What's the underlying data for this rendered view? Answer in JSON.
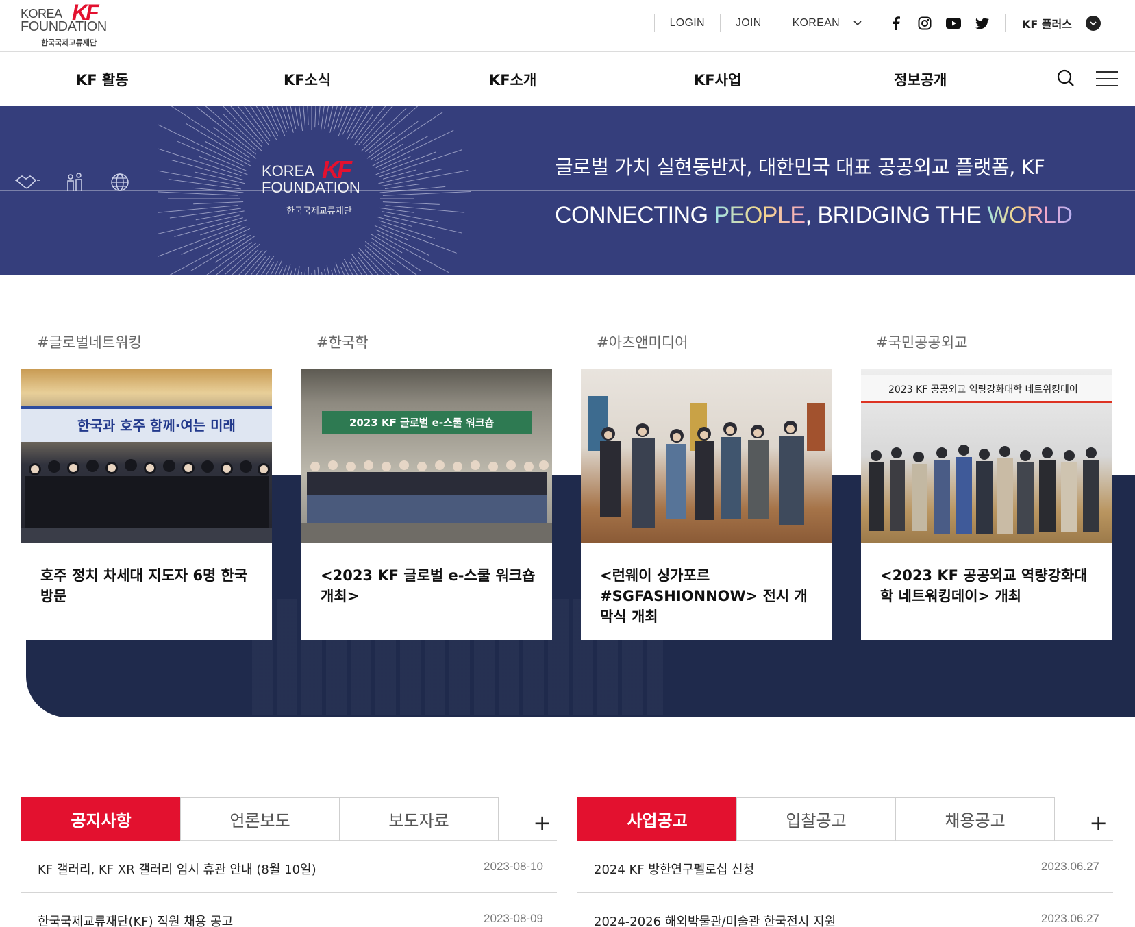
{
  "header": {
    "logo": {
      "line1": "KOREA",
      "line2": "FOUNDATION",
      "mark": "KF",
      "korean": "한국국제교류재단"
    },
    "util": {
      "login": "LOGIN",
      "join": "JOIN",
      "language": "KOREAN",
      "kfplus": "KF 플러스"
    },
    "social_icons": [
      "facebook-icon",
      "instagram-icon",
      "youtube-icon",
      "twitter-icon"
    ]
  },
  "nav": {
    "items": [
      "KF 활동",
      "KF소식",
      "KF소개",
      "KF사업",
      "정보공개"
    ]
  },
  "hero": {
    "logo": {
      "line1": "KOREA",
      "line2": "FOUNDATION",
      "mark": "KF",
      "korean": "한국국제교류재단"
    },
    "subtitle": "글로벌 가치 실현동반자, 대한민국 대표 공공외교 플랫폼, KF",
    "slogan": {
      "p1": "CONNECTING ",
      "p2": "PEOPLE",
      "p3": ", BRIDGING THE ",
      "p4": "WORLD"
    }
  },
  "cards": [
    {
      "tag": "#글로벌네트워킹",
      "title": "호주 정치 차세대 지도자 6명 한국 방문",
      "banner": "한국과 호주 함께·여는 미래"
    },
    {
      "tag": "#한국학",
      "title": "<2023 KF 글로벌 e-스쿨 워크숍 개최>",
      "banner": "2023 KF 글로벌 e-스쿨 워크숍"
    },
    {
      "tag": "#아츠앤미디어",
      "title": "<런웨이 싱가포르 #SGFASHIONNOW> 전시 개막식 개최",
      "banner": ""
    },
    {
      "tag": "#국민공공외교",
      "title": "<2023 KF 공공외교 역량강화대학 네트워킹데이> 개최",
      "banner": "2023 KF 공공외교 역량강화대학 네트워킹데이"
    }
  ],
  "board_left": {
    "tabs": [
      "공지사항",
      "언론보도",
      "보도자료"
    ],
    "more": "+",
    "rows": [
      {
        "title": "KF 갤러리, KF XR 갤러리 임시 휴관 안내 (8월 10일)",
        "date": "2023-08-10"
      },
      {
        "title": "한국국제교류재단(KF) 직원 채용 공고",
        "date": "2023-08-09"
      }
    ]
  },
  "board_right": {
    "tabs": [
      "사업공고",
      "입찰공고",
      "채용공고"
    ],
    "more": "+",
    "rows": [
      {
        "title": "2024 KF 방한연구펠로십 신청",
        "date": "2023.06.27"
      },
      {
        "title": "2024-2026 해외박물관/미술관 한국전시 지원",
        "date": "2023.06.27"
      }
    ]
  },
  "colors": {
    "brand_red": "#e3112f",
    "hero_navy": "#353e7c",
    "band_navy": "#1f2a4c"
  }
}
